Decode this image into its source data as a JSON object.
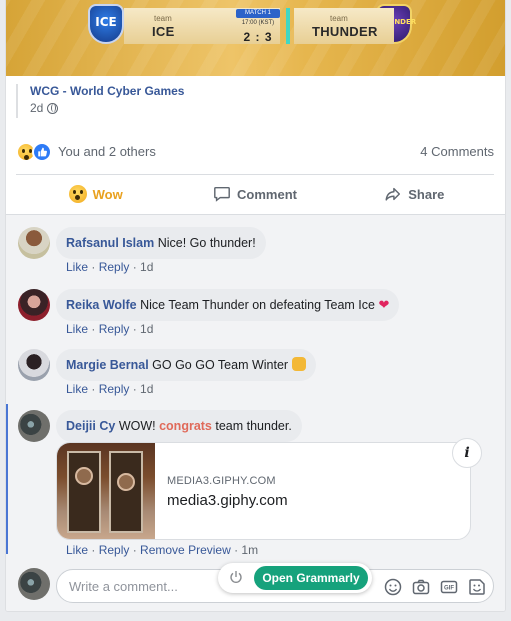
{
  "banner": {
    "left_team_small": "team",
    "left_team_name": "ICE",
    "right_team_small": "team",
    "right_team_name": "THUNDER",
    "match_label": "MATCH 1",
    "match_time": "17:00 (KST)",
    "score": "2 : 3",
    "logo_left": "ICE",
    "logo_right": "THUNDER"
  },
  "post": {
    "source_name": "WCG - World Cyber Games",
    "age": "2d",
    "reactions_text": "You and 2 others",
    "comments_count": "4 Comments"
  },
  "actions": {
    "wow": "Wow",
    "comment": "Comment",
    "share": "Share"
  },
  "comments": [
    {
      "author": "Rafsanul Islam",
      "text": "Nice! Go thunder!",
      "like": "Like",
      "reply": "Reply",
      "time": "1d"
    },
    {
      "author": "Reika Wolfe",
      "text": "Nice Team Thunder on defeating Team Ice",
      "emoji": "❤",
      "like": "Like",
      "reply": "Reply",
      "time": "1d"
    },
    {
      "author": "Margie Bernal",
      "text": "GO Go GO Team Winter",
      "like": "Like",
      "reply": "Reply",
      "time": "1d"
    },
    {
      "author": "Deijii Cy",
      "text_pre": "WOW!",
      "text_highlight": "congrats",
      "text_post": "team thunder.",
      "like": "Like",
      "reply": "Reply",
      "remove_preview": "Remove Preview",
      "time": "1m"
    }
  ],
  "preview": {
    "domain": "MEDIA3.GIPHY.COM",
    "title": "media3.giphy.com",
    "info": "i"
  },
  "composer": {
    "placeholder": "Write a comment..."
  },
  "grammarly": {
    "button": "Open Grammarly"
  },
  "colors": {
    "link": "#385898",
    "wow": "#e9a11f",
    "grammarly": "#16a27c",
    "highlight": "#e06a5a"
  }
}
